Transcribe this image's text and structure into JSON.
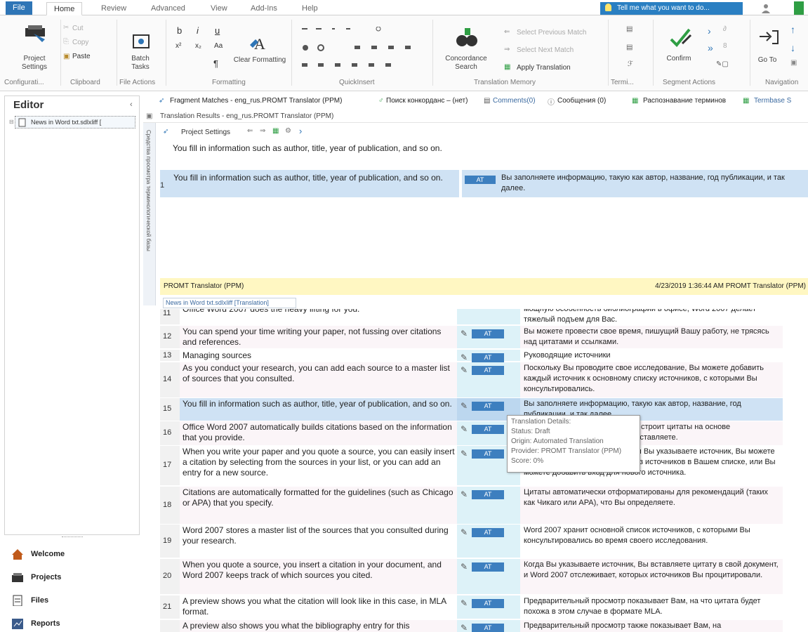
{
  "tabs": [
    "File",
    "Home",
    "Review",
    "Advanced",
    "View",
    "Add-Ins",
    "Help"
  ],
  "tell_me": "Tell me what you want to do...",
  "ribbon": {
    "project_settings": "Project Settings",
    "cut": "Cut",
    "copy": "Copy",
    "paste": "Paste",
    "batch_tasks": "Batch Tasks",
    "clear_formatting": "Clear Formatting",
    "concordance_search": "Concordance Search",
    "select_prev_match": "Select Previous Match",
    "select_next_match": "Select Next Match",
    "apply_translation": "Apply Translation",
    "confirm": "Confirm",
    "go_to": "Go To",
    "groups": [
      "Configurati...",
      "Clipboard",
      "File Actions",
      "Formatting",
      "QuickInsert",
      "Translation Memory",
      "Termi...",
      "Segment Actions",
      "Navigation"
    ]
  },
  "editor": {
    "title": "Editor",
    "tree_item": "News in Word txt.sdlxliff [",
    "nav": [
      "Welcome",
      "Projects",
      "Files",
      "Reports"
    ]
  },
  "toolrow": {
    "fragment": "Fragment Matches - eng_rus.PROMT Translator (PPM)",
    "concordance": "Поиск конкорданс – (нет)",
    "comments": "Comments(0)",
    "messages": "Сообщения (0)",
    "term_recognition": "Распознавание терминов",
    "termbase": "Termbase S"
  },
  "translation_results": {
    "header": "Translation Results - eng_rus.PROMT Translator (PPM)",
    "project_settings": "Project Settings",
    "source_plain": "You fill in information such as author, title, year of publication, and so on.",
    "row_num": "1",
    "row_source": "You fill in information such as author, title, year of publication, and so on.",
    "row_at": "AT",
    "row_target": "Вы заполняете информацию, такую как автор, название, год публикации, и так далее.",
    "vertical_label": "Средства просмотра терминологической базы",
    "provider_left": "PROMT Translator (PPM)",
    "provider_right": "4/23/2019 1:36:44 AM  PROMT Translator (PPM)"
  },
  "doc_tab": "News in Word txt.sdlxliff [Translation]",
  "segments": [
    {
      "num": "11",
      "src": "Office Word 2007 does the heavy lifting for you.",
      "tgt": "мощную особенность библиографии в офисе, Word 2007 делает тяжелый подъем для Вас.",
      "at": "",
      "active": false
    },
    {
      "num": "12",
      "src": "You can spend your time writing your paper, not fussing over citations and references.",
      "tgt": "Вы можете провести свое время, пишущий Вашу работу, не трясясь над цитатами и ссылками.",
      "at": "AT",
      "active": false
    },
    {
      "num": "13",
      "src": "Managing sources",
      "tgt": "Руководящие источники",
      "at": "AT",
      "active": false
    },
    {
      "num": "14",
      "src": "As you conduct your research, you can add each source to a master list of sources that you consulted.",
      "tgt": "Поскольку Вы проводите свое исследование, Вы можете добавить каждый источник к основному списку источников, с которыми Вы консультировались.",
      "at": "AT",
      "active": false
    },
    {
      "num": "15",
      "src": "You fill in information such as author, title, year of publication, and so on.",
      "tgt": "Вы заполняете информацию, такую как автор, название, год публикации, и так далее.",
      "at": "AT",
      "active": true
    },
    {
      "num": "16",
      "src": "Office Word 2007 automatically builds citations based on the information that you provide.",
      "tgt": "Office Word 2007 автоматически строит цитаты на основе информации, которую Вы предоставляете.",
      "at": "AT",
      "active": false
    },
    {
      "num": "17",
      "src": "When you write your paper and you quote a source, you can easily insert a citation by selecting from the sources in your list, or you can add an entry for a new source.",
      "tgt": "Когда Вы пишете Вашу работу, и Вы указываете источник, Вы можете легко вставить цитату, выбрав из источников в Вашем списке, или Вы можете добавить вход для нового источника.",
      "at": "AT",
      "active": false
    },
    {
      "num": "18",
      "src": "Citations are automatically formatted for the guidelines (such as Chicago or APA) that you specify.",
      "tgt": "Цитаты автоматически отформатированы для рекомендаций (таких как Чикаго или APA), что Вы определяете.",
      "at": "AT",
      "active": false
    },
    {
      "num": "19",
      "src": "Word 2007 stores a master list of the sources that you consulted during your research.",
      "tgt": "Word 2007 хранит основной список источников, с которыми Вы консультировались во время своего исследования.",
      "at": "AT",
      "active": false
    },
    {
      "num": "20",
      "src": "When you quote a source, you insert a citation in your document, and Word 2007 keeps track of which sources you cited.",
      "tgt": "Когда Вы указываете источник, Вы вставляете цитату в свой документ, и Word 2007 отслеживает, которых источников Вы процитировали.",
      "at": "AT",
      "active": false
    },
    {
      "num": "21",
      "src": "A preview shows you what the citation will look like  in this case, in MLA format.",
      "tgt": "Предварительный просмотр показывает Вам, на что цитата будет похожа   в этом случае в формате MLA.",
      "at": "AT",
      "active": false
    },
    {
      "num": "",
      "src": "A preview also shows you what the bibliography entry for this",
      "tgt": "Предварительный просмотр также показывает Вам, на",
      "at": "AT",
      "active": false
    }
  ],
  "tooltip": [
    "Translation Details:",
    "Status: Draft",
    "Origin: Automated Translation",
    "Provider: PROMT Translator (PPM)",
    "Score: 0%"
  ]
}
